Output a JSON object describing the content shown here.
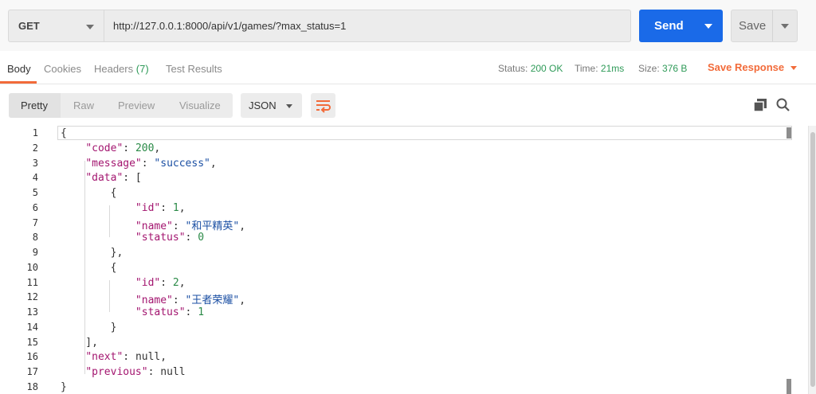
{
  "request": {
    "method": "GET",
    "url": "http://127.0.0.1:8000/api/v1/games/?max_status=1",
    "send_label": "Send",
    "save_label": "Save"
  },
  "response_tabs": {
    "body": "Body",
    "cookies": "Cookies",
    "headers": "Headers",
    "headers_count": "(7)",
    "test_results": "Test Results"
  },
  "response_meta": {
    "status_label": "Status:",
    "status_value": "200 OK",
    "time_label": "Time:",
    "time_value": "21ms",
    "size_label": "Size:",
    "size_value": "376 B",
    "save_response": "Save Response"
  },
  "view_modes": {
    "pretty": "Pretty",
    "raw": "Raw",
    "preview": "Preview",
    "visualize": "Visualize",
    "format": "JSON"
  },
  "code": {
    "line_numbers": [
      "1",
      "2",
      "3",
      "4",
      "5",
      "6",
      "7",
      "8",
      "9",
      "10",
      "11",
      "12",
      "13",
      "14",
      "15",
      "16",
      "17",
      "18"
    ],
    "lines": [
      [
        {
          "t": "p",
          "v": "{"
        }
      ],
      [
        {
          "t": "p",
          "v": "    "
        },
        {
          "t": "k",
          "v": "\"code\""
        },
        {
          "t": "p",
          "v": ": "
        },
        {
          "t": "n",
          "v": "200"
        },
        {
          "t": "p",
          "v": ","
        }
      ],
      [
        {
          "t": "p",
          "v": "    "
        },
        {
          "t": "k",
          "v": "\"message\""
        },
        {
          "t": "p",
          "v": ": "
        },
        {
          "t": "s",
          "v": "\"success\""
        },
        {
          "t": "p",
          "v": ","
        }
      ],
      [
        {
          "t": "p",
          "v": "    "
        },
        {
          "t": "k",
          "v": "\"data\""
        },
        {
          "t": "p",
          "v": ": ["
        }
      ],
      [
        {
          "t": "p",
          "v": "        {"
        }
      ],
      [
        {
          "t": "p",
          "v": "            "
        },
        {
          "t": "k",
          "v": "\"id\""
        },
        {
          "t": "p",
          "v": ": "
        },
        {
          "t": "n",
          "v": "1"
        },
        {
          "t": "p",
          "v": ","
        }
      ],
      [
        {
          "t": "p",
          "v": "            "
        },
        {
          "t": "k",
          "v": "\"name\""
        },
        {
          "t": "p",
          "v": ": "
        },
        {
          "t": "s",
          "v": "\"和平精英\""
        },
        {
          "t": "p",
          "v": ","
        }
      ],
      [
        {
          "t": "p",
          "v": "            "
        },
        {
          "t": "k",
          "v": "\"status\""
        },
        {
          "t": "p",
          "v": ": "
        },
        {
          "t": "n",
          "v": "0"
        }
      ],
      [
        {
          "t": "p",
          "v": "        },"
        }
      ],
      [
        {
          "t": "p",
          "v": "        {"
        }
      ],
      [
        {
          "t": "p",
          "v": "            "
        },
        {
          "t": "k",
          "v": "\"id\""
        },
        {
          "t": "p",
          "v": ": "
        },
        {
          "t": "n",
          "v": "2"
        },
        {
          "t": "p",
          "v": ","
        }
      ],
      [
        {
          "t": "p",
          "v": "            "
        },
        {
          "t": "k",
          "v": "\"name\""
        },
        {
          "t": "p",
          "v": ": "
        },
        {
          "t": "s",
          "v": "\"王者荣耀\""
        },
        {
          "t": "p",
          "v": ","
        }
      ],
      [
        {
          "t": "p",
          "v": "            "
        },
        {
          "t": "k",
          "v": "\"status\""
        },
        {
          "t": "p",
          "v": ": "
        },
        {
          "t": "n",
          "v": "1"
        }
      ],
      [
        {
          "t": "p",
          "v": "        }"
        }
      ],
      [
        {
          "t": "p",
          "v": "    ],"
        }
      ],
      [
        {
          "t": "p",
          "v": "    "
        },
        {
          "t": "k",
          "v": "\"next\""
        },
        {
          "t": "p",
          "v": ": "
        },
        {
          "t": "p",
          "v": "null"
        },
        {
          "t": "p",
          "v": ","
        }
      ],
      [
        {
          "t": "p",
          "v": "    "
        },
        {
          "t": "k",
          "v": "\"previous\""
        },
        {
          "t": "p",
          "v": ": "
        },
        {
          "t": "p",
          "v": "null"
        }
      ],
      [
        {
          "t": "p",
          "v": "}"
        }
      ]
    ]
  },
  "icons": {
    "copy": "copy-icon",
    "search": "search-icon",
    "wrap": "wrap-lines-icon"
  },
  "colors": {
    "send": "#1a6ae8",
    "accent": "#f26b3a",
    "status_ok": "#2e9a58"
  }
}
